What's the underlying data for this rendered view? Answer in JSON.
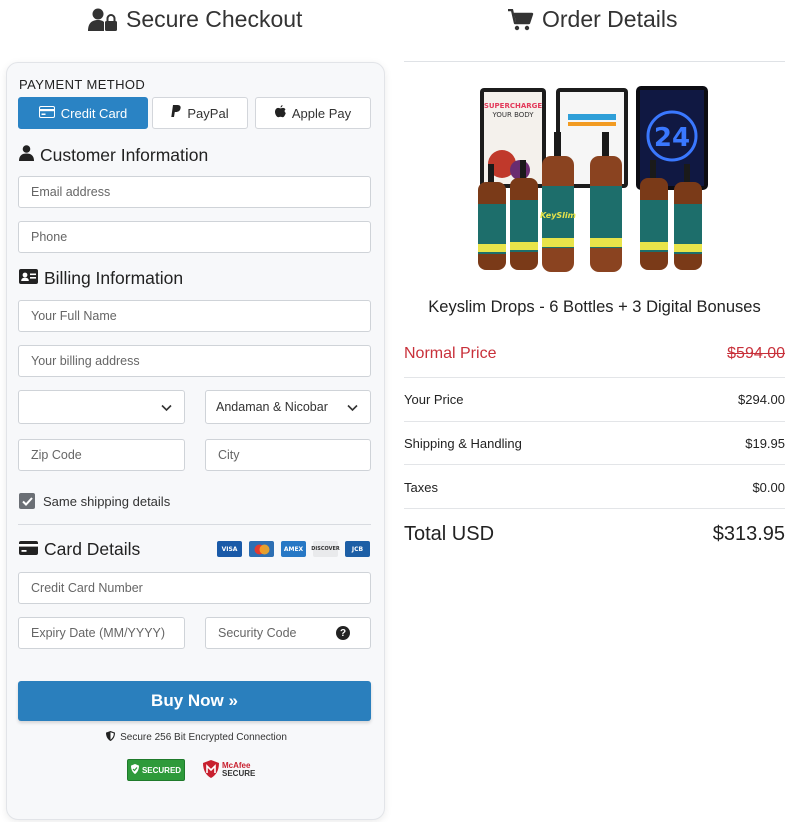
{
  "left_title": "Secure Checkout",
  "right_title": "Order Details",
  "payment": {
    "label": "PAYMENT METHOD",
    "methods": [
      {
        "label": "Credit Card",
        "active": true
      },
      {
        "label": "PayPal",
        "active": false
      },
      {
        "label": "Apple Pay",
        "active": false
      }
    ]
  },
  "customer": {
    "title": "Customer Information",
    "email_placeholder": "Email address",
    "phone_placeholder": "Phone"
  },
  "billing": {
    "title": "Billing Information",
    "name_placeholder": "Your Full Name",
    "address_placeholder": "Your billing address",
    "country_value": "",
    "state_value": "Andaman & Nicobar",
    "zip_placeholder": "Zip Code",
    "city_placeholder": "City",
    "same_shipping_label": "Same shipping details",
    "same_shipping_checked": true
  },
  "card": {
    "title": "Card Details",
    "logos": [
      "VISA",
      "mastercard",
      "AMEX",
      "DISCOVER",
      "JCB"
    ],
    "number_placeholder": "Credit Card Number",
    "expiry_placeholder": "Expiry Date (MM/YYYY)",
    "cvv_placeholder": "Security Code"
  },
  "buy_button": "Buy Now »",
  "secure_note": "Secure 256 Bit Encrypted Connection",
  "badges": {
    "secured_line1": "SECURED",
    "mcafee_line1": "McAfee",
    "mcafee_line2": "SECURE"
  },
  "order": {
    "product_name": "Keyslim Drops - 6 Bottles + 3 Digital Bonuses",
    "image_texts": {
      "book1": "SUPERCHARGE YOUR BODY",
      "bottle_label": "KeySlim",
      "tablet": "24"
    },
    "normal_price_label": "Normal Price",
    "normal_price": "$594.00",
    "your_price_label": "Your Price",
    "your_price": "$294.00",
    "shipping_label": "Shipping & Handling",
    "shipping": "$19.95",
    "taxes_label": "Taxes",
    "taxes": "$0.00",
    "total_label": "Total USD",
    "total": "$313.95"
  },
  "colors": {
    "accent": "#2a83c4",
    "normal_price": "#c8303a",
    "panel_bg": "#f7f8fa"
  }
}
